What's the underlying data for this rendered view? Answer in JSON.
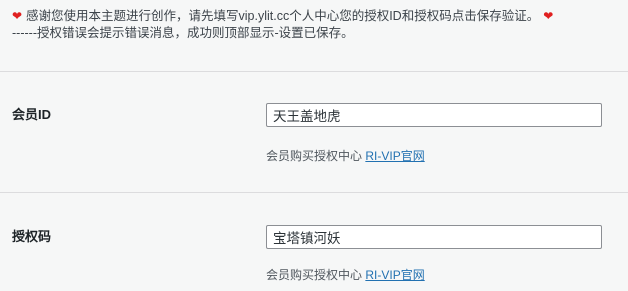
{
  "notice": {
    "line1": "感谢您使用本主题进行创作，请先填写vip.ylit.cc个人中心您的授权ID和授权码点击保存验证。",
    "line2": "------授权错误会提示错误消息，成功则顶部显示-设置已保存。",
    "heart_glyph": "❤"
  },
  "fields": [
    {
      "label": "会员ID",
      "value": "天王盖地虎",
      "desc_text": "会员购买授权中心",
      "desc_link": "RI-VIP官网"
    },
    {
      "label": "授权码",
      "value": "宝塔镇河妖",
      "desc_text": "会员购买授权中心",
      "desc_link": "RI-VIP官网"
    }
  ]
}
